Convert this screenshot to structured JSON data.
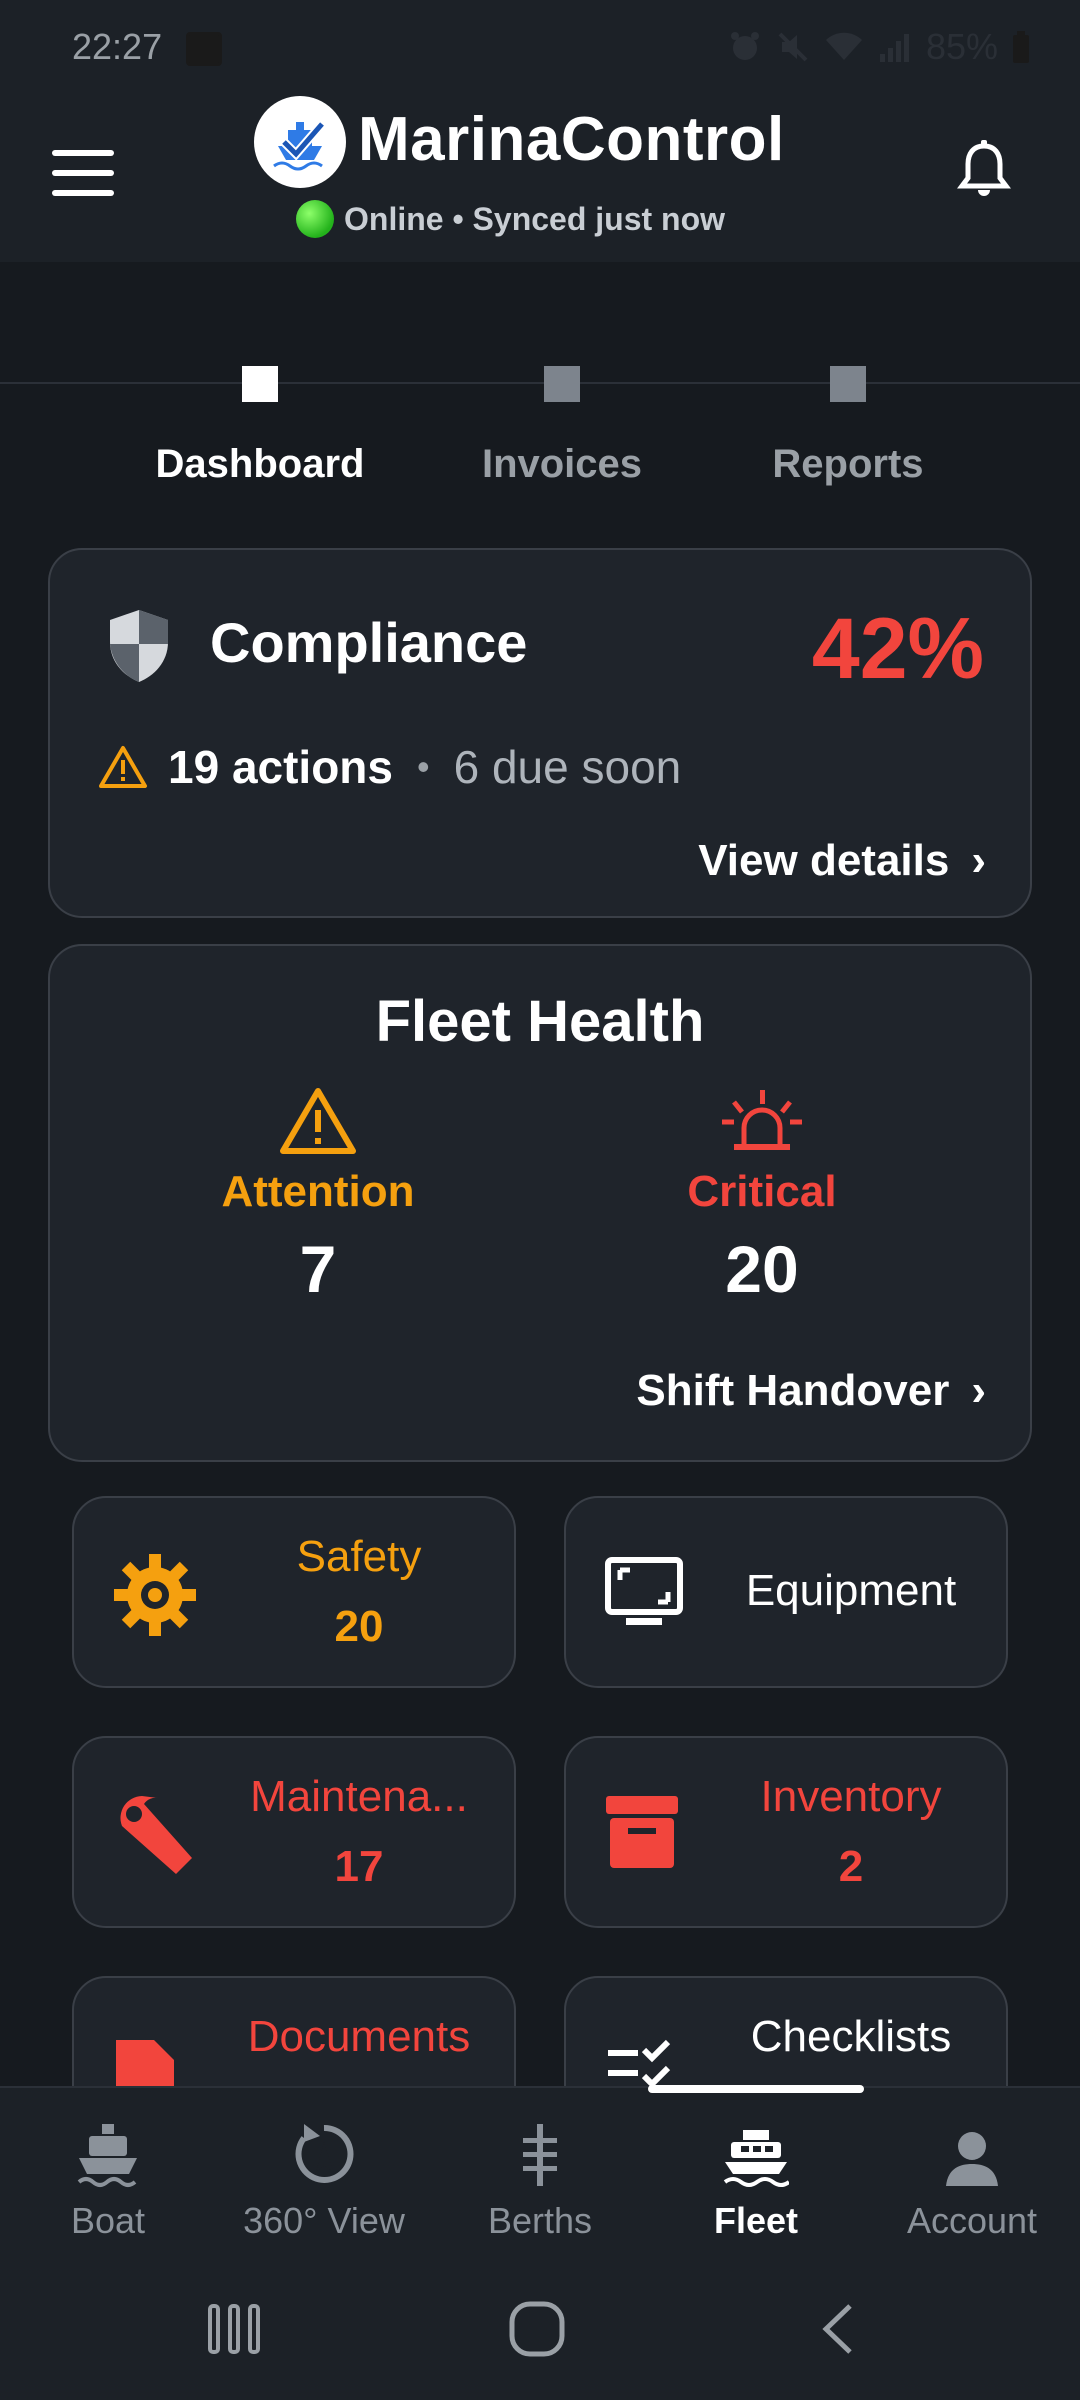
{
  "status_bar": {
    "time": "22:27",
    "battery": "85%"
  },
  "app": {
    "title": "MarinaControl",
    "sync_status": "Online • Synced just now"
  },
  "tabs": [
    {
      "label": "Dashboard",
      "active": true
    },
    {
      "label": "Invoices",
      "active": false
    },
    {
      "label": "Reports",
      "active": false
    }
  ],
  "compliance": {
    "title": "Compliance",
    "percent": "42%",
    "actions": "19 actions",
    "separator": "•",
    "due": "6 due soon",
    "link": "View details",
    "chevron": "›"
  },
  "fleet_health": {
    "title": "Fleet Health",
    "attention_label": "Attention",
    "attention_count": "7",
    "critical_label": "Critical",
    "critical_count": "20",
    "link": "Shift Handover",
    "chevron": "›"
  },
  "tiles": [
    {
      "label": "Safety",
      "count": "20",
      "icon": "gear-warning-icon",
      "color": "#f5a00f"
    },
    {
      "label": "Equipment",
      "count": "",
      "icon": "monitor-icon",
      "color": "#ffffff"
    },
    {
      "label": "Maintena...",
      "count": "17",
      "icon": "wrench-icon",
      "color": "#f2453d"
    },
    {
      "label": "Inventory",
      "count": "2",
      "icon": "archive-box-icon",
      "color": "#f2453d"
    },
    {
      "label": "Documents",
      "count": "",
      "icon": "document-icon",
      "color": "#f2453d"
    },
    {
      "label": "Checklists",
      "count": "",
      "icon": "checklist-icon",
      "color": "#ffffff"
    }
  ],
  "bottom_nav": [
    {
      "label": "Boat",
      "icon": "boat-icon",
      "active": false
    },
    {
      "label": "360° View",
      "icon": "rotate-360-icon",
      "active": false
    },
    {
      "label": "Berths",
      "icon": "berths-icon",
      "active": false
    },
    {
      "label": "Fleet",
      "icon": "fleet-icon",
      "active": true
    },
    {
      "label": "Account",
      "icon": "account-icon",
      "active": false
    }
  ],
  "colors": {
    "accent_red": "#f2453d",
    "accent_orange": "#f5a00f",
    "background": "#161a1f",
    "card": "#1f242b"
  }
}
